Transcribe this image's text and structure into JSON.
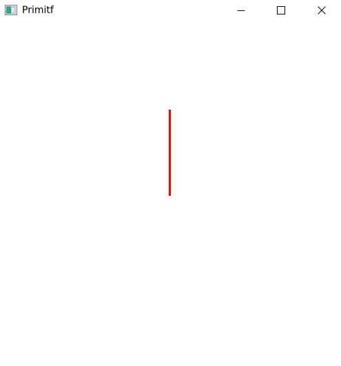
{
  "window": {
    "title": "Primitf",
    "app_icon": "window-app-icon",
    "controls": {
      "minimize_icon": "minimize-icon",
      "maximize_icon": "maximize-icon",
      "close_icon": "close-icon"
    }
  },
  "canvas": {
    "background_color": "#ffffff",
    "shapes": [
      {
        "type": "line",
        "color": "#ff0000"
      }
    ]
  }
}
